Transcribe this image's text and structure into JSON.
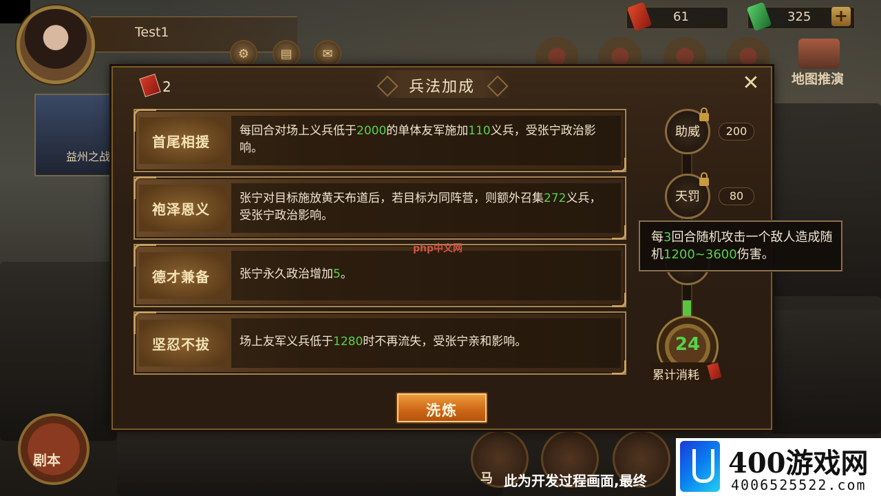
{
  "hud": {
    "player_name": "Test1",
    "resource_red_value": "61",
    "resource_green_value": "325",
    "plus_label": "+",
    "map_label": "地图推演",
    "left_card_label": "益州之战",
    "left_round_label": "剧本",
    "bottom_icon_label": "马"
  },
  "dialog": {
    "title": "兵法加成",
    "book_count": "2",
    "close_label": "✕",
    "skills": [
      {
        "name": "首尾相援",
        "desc_parts": [
          "每回合对场上义兵低于",
          "2000",
          "的单体友军施加",
          "110",
          "义兵，受张宁政治影响。"
        ]
      },
      {
        "name": "袍泽恩义",
        "desc_parts": [
          "张宁对目标施放黄天布道后，若目标为同阵营，则额外召集",
          "272",
          "义兵，受张宁政治影响。"
        ]
      },
      {
        "name": "德才兼备",
        "desc_parts": [
          "张宁永久政治增加",
          "5",
          "。"
        ]
      },
      {
        "name": "坚忍不拔",
        "desc_parts": [
          "场上友军义兵低于",
          "1280",
          "时不再流失，受张宁亲和影响。"
        ]
      }
    ],
    "refine_label": "洗炼",
    "tiers": [
      {
        "label": "助威",
        "cost": "200",
        "locked": true
      },
      {
        "label": "天罚",
        "cost": "80",
        "locked": true
      }
    ],
    "progress_fraction": 0.1,
    "total_value": "24",
    "total_label": "累计消耗"
  },
  "tooltip": {
    "parts": [
      "每",
      "3",
      "回合随机攻击一个敌人造成随机",
      "1200~3600",
      "伤害。"
    ]
  },
  "overlay": {
    "php_watermark": "php中文网",
    "footer_caption": "此为开发过程画面,最终",
    "brand_name": "400游戏网",
    "brand_phone": "4006525522.com"
  },
  "colors": {
    "highlight": "#56d24a",
    "accent": "#d06a18"
  }
}
